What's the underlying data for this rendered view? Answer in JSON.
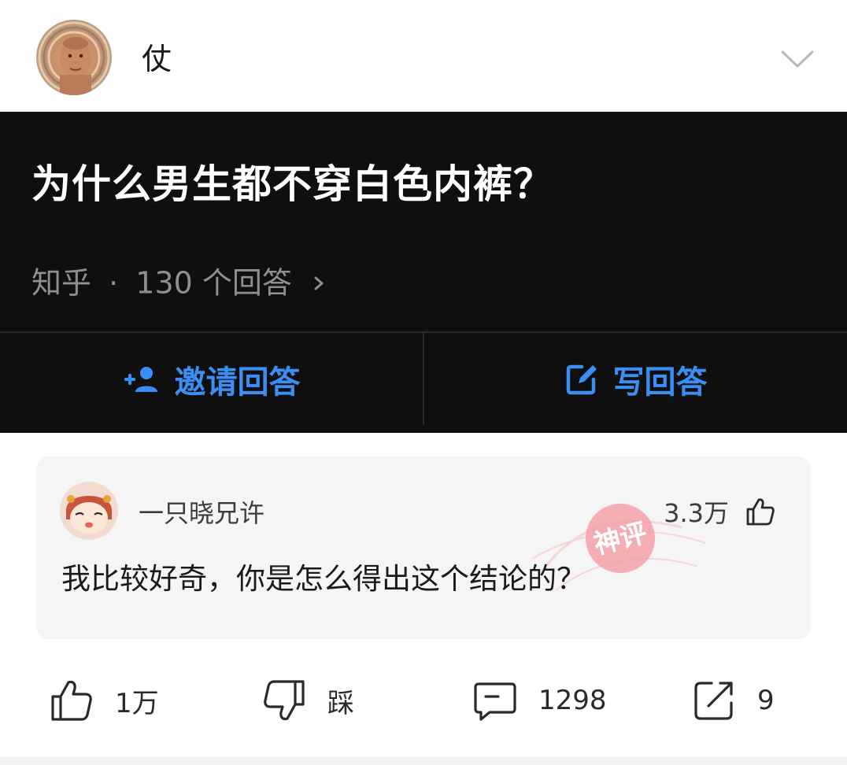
{
  "header": {
    "author_name": "仗",
    "avatar_icon": "author-avatar",
    "collapse_icon": "chevron-down-icon"
  },
  "question": {
    "title": "为什么男生都不穿白色内裤？",
    "source": "知乎",
    "separator": "·",
    "answer_count": "130 个回答",
    "chevron_icon": "chevron-right-icon",
    "invite_label": "邀请回答",
    "write_label": "写回答",
    "accent_color": "#3a8ff5",
    "background_color": "#0f0f10"
  },
  "comment": {
    "username": "一只晓兄许",
    "likes": "3.3万",
    "text": "我比较好奇，你是怎么得出这个结论的？",
    "stamp_text": "神评",
    "stamp_color": "#f3a0a6",
    "like_icon": "thumb-up-icon"
  },
  "actions": {
    "upvote_count": "1万",
    "downvote_label": "踩",
    "comment_count": "1298",
    "share_count": "9"
  }
}
